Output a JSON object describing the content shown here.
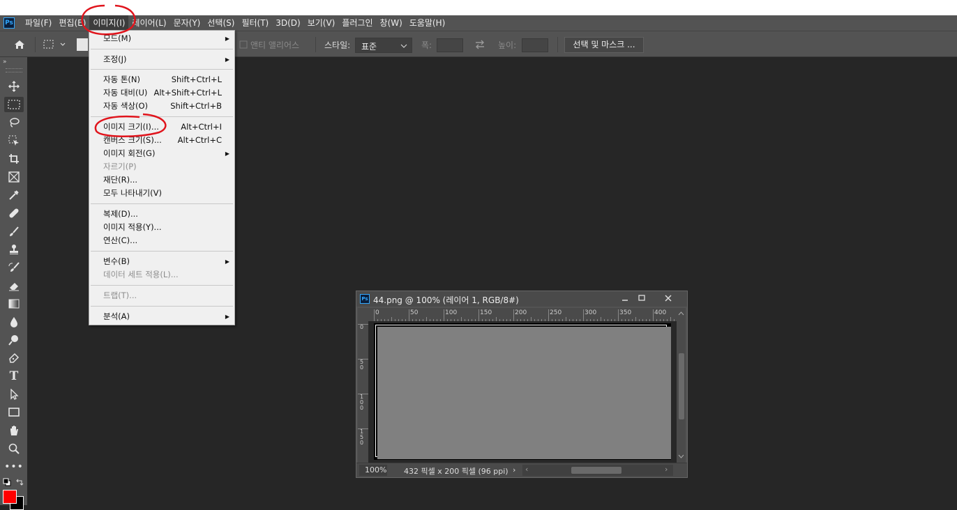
{
  "menubar": {
    "items": [
      "파일(F)",
      "편집(E)",
      "이미지(I)",
      "레이어(L)",
      "문자(Y)",
      "선택(S)",
      "필터(T)",
      "3D(D)",
      "보기(V)",
      "플러그인",
      "창(W)",
      "도움말(H)"
    ],
    "active_index": 2
  },
  "options_bar": {
    "antialias_label": "앤티 앨리어스",
    "style_label": "스타일:",
    "style_value": "표준",
    "width_label": "폭:",
    "height_label": "높이:",
    "select_mask_button": "선택 및 마스크 ..."
  },
  "image_menu": {
    "items": [
      {
        "label": "모드(M)",
        "shortcut": "",
        "submenu": true,
        "disabled": false
      },
      {
        "label": "조정(J)",
        "shortcut": "",
        "submenu": true,
        "disabled": false
      },
      {
        "label": "자동 톤(N)",
        "shortcut": "Shift+Ctrl+L",
        "submenu": false,
        "disabled": false
      },
      {
        "label": "자동 대비(U)",
        "shortcut": "Alt+Shift+Ctrl+L",
        "submenu": false,
        "disabled": false
      },
      {
        "label": "자동 색상(O)",
        "shortcut": "Shift+Ctrl+B",
        "submenu": false,
        "disabled": false
      },
      {
        "label": "이미지 크기(I)...",
        "shortcut": "Alt+Ctrl+I",
        "submenu": false,
        "disabled": false
      },
      {
        "label": "캔버스 크기(S)...",
        "shortcut": "Alt+Ctrl+C",
        "submenu": false,
        "disabled": false
      },
      {
        "label": "이미지 회전(G)",
        "shortcut": "",
        "submenu": true,
        "disabled": false
      },
      {
        "label": "자르기(P)",
        "shortcut": "",
        "submenu": false,
        "disabled": true
      },
      {
        "label": "재단(R)...",
        "shortcut": "",
        "submenu": false,
        "disabled": false
      },
      {
        "label": "모두 나타내기(V)",
        "shortcut": "",
        "submenu": false,
        "disabled": false
      },
      {
        "label": "복제(D)...",
        "shortcut": "",
        "submenu": false,
        "disabled": false
      },
      {
        "label": "이미지 적용(Y)...",
        "shortcut": "",
        "submenu": false,
        "disabled": false
      },
      {
        "label": "연산(C)...",
        "shortcut": "",
        "submenu": false,
        "disabled": false
      },
      {
        "label": "변수(B)",
        "shortcut": "",
        "submenu": true,
        "disabled": false
      },
      {
        "label": "데이터 세트 적용(L)...",
        "shortcut": "",
        "submenu": false,
        "disabled": true
      },
      {
        "label": "트랩(T)...",
        "shortcut": "",
        "submenu": false,
        "disabled": true
      },
      {
        "label": "분석(A)",
        "shortcut": "",
        "submenu": true,
        "disabled": false
      }
    ]
  },
  "document": {
    "title": "44.png @ 100% (레이어 1, RGB/8#)",
    "zoom": "100%",
    "dimensions": "432 픽셀 x 200 픽셀 (96 ppi)",
    "ruler_top": [
      "0",
      "50",
      "100",
      "150",
      "200",
      "250",
      "300",
      "350",
      "400"
    ],
    "ruler_left": [
      "0",
      "5 0",
      "1 0 0",
      "1 5 0"
    ]
  },
  "colors": {
    "foreground": "#ff0000",
    "background": "#000000",
    "annotation": "#e0141c",
    "ps_accent": "#31a8ff"
  }
}
